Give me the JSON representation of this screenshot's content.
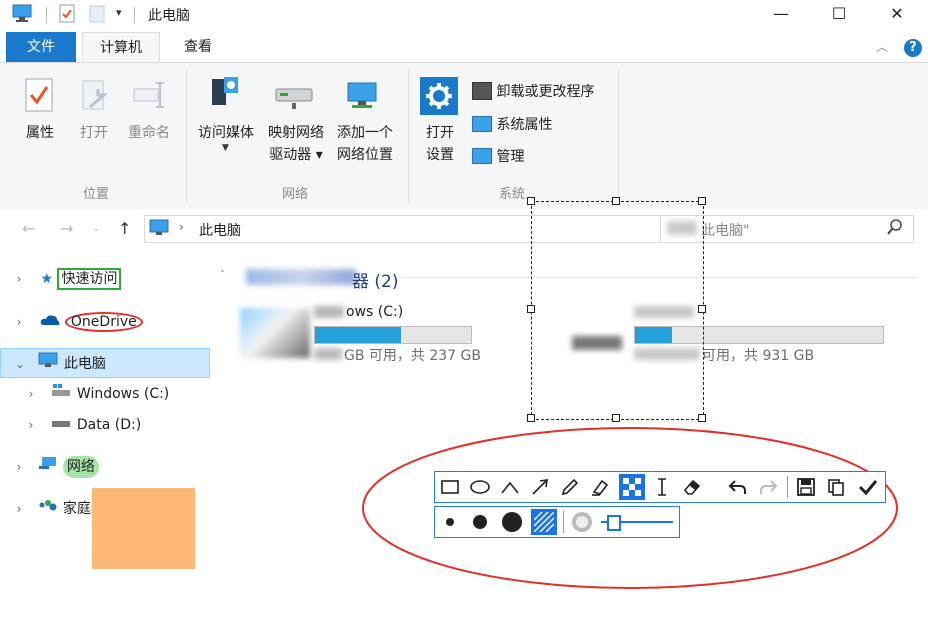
{
  "window": {
    "title": "此电脑",
    "minimize_glyph": "—",
    "maximize_glyph": "☐",
    "close_glyph": "✕"
  },
  "ribbon_tabs": [
    {
      "label": "文件"
    },
    {
      "label": "计算机"
    },
    {
      "label": "查看"
    }
  ],
  "ribbon": {
    "location": {
      "group_label": "位置",
      "properties": "属性",
      "open": "打开",
      "rename": "重命名"
    },
    "network": {
      "group_label": "网络",
      "access_media": "访问媒体",
      "map_drive_line1": "映射网络",
      "map_drive_line2": "驱动器 ▾",
      "add_location_line1": "添加一个",
      "add_location_line2": "网络位置"
    },
    "system": {
      "group_label": "系统",
      "open_settings_line1": "打开",
      "open_settings_line2": "设置",
      "uninstall": "卸载或更改程序",
      "system_properties": "系统属性",
      "manage": "管理"
    }
  },
  "address": {
    "path": "此电脑",
    "search_placeholder": "此电脑\""
  },
  "nav_pane": {
    "items": [
      {
        "label": "快速访问"
      },
      {
        "label": "OneDrive"
      },
      {
        "label": "此电脑"
      },
      {
        "label": "Windows (C:)"
      },
      {
        "label": "Data (D:)"
      },
      {
        "label": "网络"
      },
      {
        "label": "家庭组"
      }
    ]
  },
  "content": {
    "section_header_suffix": "器 (2)",
    "drives": [
      {
        "name_fragment": "ows (C:)",
        "space_fragment": "GB 可用，共 237 GB",
        "fill_ratio": 0.55
      },
      {
        "name_fragment": "",
        "space_fragment": "可用，共 931 GB",
        "fill_ratio": 0.15
      }
    ]
  },
  "screenshot_toolbar": {
    "tools": [
      {
        "icon": "rectangle-icon"
      },
      {
        "icon": "ellipse-icon"
      },
      {
        "icon": "polyline-icon"
      },
      {
        "icon": "arrow-icon"
      },
      {
        "icon": "pencil-icon"
      },
      {
        "icon": "highlighter-icon"
      },
      {
        "icon": "mosaic-icon",
        "selected": true
      },
      {
        "icon": "text-icon"
      },
      {
        "icon": "eraser-icon"
      },
      {
        "icon": "undo-icon"
      },
      {
        "icon": "redo-icon"
      },
      {
        "icon": "save-icon"
      },
      {
        "icon": "copy-icon"
      },
      {
        "icon": "done-icon"
      }
    ],
    "options": [
      {
        "icon": "small-dot-icon"
      },
      {
        "icon": "medium-dot-icon"
      },
      {
        "icon": "large-dot-icon"
      },
      {
        "icon": "hatch-brush-icon",
        "selected": true
      },
      {
        "icon": "blur-brush-icon"
      }
    ]
  },
  "colors": {
    "accent": "#1979ca",
    "selection_bg": "#cce8ff",
    "annotation_red": "#e0302a",
    "annotation_green": "#2eaa3a",
    "orange_block": "#ffb977",
    "drive_bar": "#26a0da"
  }
}
